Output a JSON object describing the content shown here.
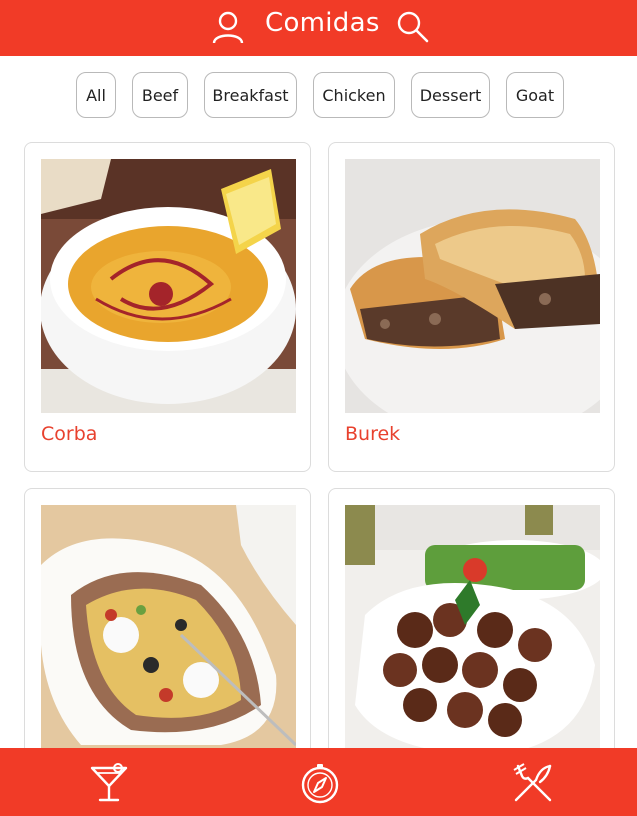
{
  "header": {
    "title": "Comidas",
    "user_icon": "user-icon",
    "search_icon": "search-icon",
    "color": "#f13b27"
  },
  "filters": [
    "All",
    "Beef",
    "Breakfast",
    "Chicken",
    "Dessert",
    "Goat"
  ],
  "meals": [
    {
      "name": "Corba",
      "image": "lentil-soup-photo"
    },
    {
      "name": "Burek",
      "image": "meat-pastry-photo"
    },
    {
      "name": "",
      "image": "stuffed-potato-photo"
    },
    {
      "name": "",
      "image": "falafel-photo"
    }
  ],
  "bottom_nav": [
    {
      "icon": "cocktail-icon"
    },
    {
      "icon": "compass-icon"
    },
    {
      "icon": "fork-knife-icon"
    }
  ],
  "accent_text_color": "#e8412e"
}
